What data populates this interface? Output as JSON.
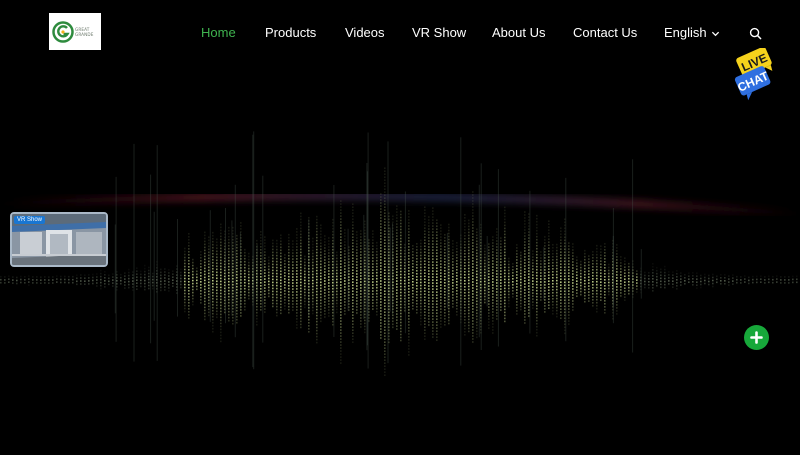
{
  "logo": {
    "text_line1": "GREAT",
    "text_line2": "GRANDE",
    "icon": "great-grande-logo",
    "brand_color": "#2e8b3e"
  },
  "nav": {
    "items": [
      {
        "label": "Home",
        "active": true
      },
      {
        "label": "Products",
        "active": false
      },
      {
        "label": "Videos",
        "active": false
      },
      {
        "label": "VR Show",
        "active": false
      },
      {
        "label": "About Us",
        "active": false
      },
      {
        "label": "Contact Us",
        "active": false
      }
    ],
    "language": "English",
    "active_color": "#3fb34f"
  },
  "search": {
    "icon": "search-icon"
  },
  "live_chat": {
    "line1": "LIVE",
    "line2": "CHAT",
    "colors": {
      "yellow": "#f5d21c",
      "blue": "#2f6fe0"
    }
  },
  "vr_thumbnail": {
    "badge": "VR Show"
  },
  "plus_button": {
    "icon": "plus-icon",
    "color": "#17a83a"
  }
}
